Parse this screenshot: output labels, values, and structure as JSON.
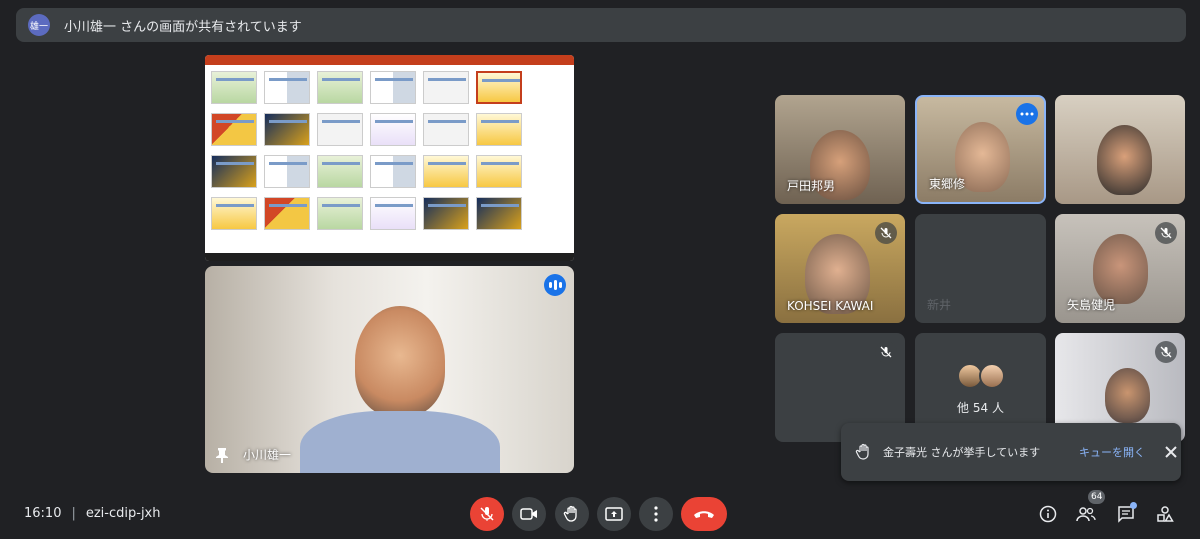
{
  "banner": {
    "avatar_text": "雄一",
    "text": "小川雄一 さんの画面が共有されています"
  },
  "presenter": {
    "name": "小川雄一"
  },
  "participants": [
    {
      "name": "戸田邦男"
    },
    {
      "name": "東郷修"
    },
    {
      "name": ""
    },
    {
      "name": "KOHSEI KAWAI"
    },
    {
      "name": "新井"
    },
    {
      "name": "矢島健児"
    },
    {
      "name": ""
    },
    {
      "name": ""
    }
  ],
  "others": {
    "label": "他 54 人"
  },
  "toast": {
    "text": "金子壽光 さんが挙手しています",
    "link": "キューを開く"
  },
  "meeting": {
    "time": "16:10",
    "code": "ezi-cdip-jxh",
    "participant_count": "64"
  },
  "colors": {
    "background": "#202124",
    "tile": "#3c4043",
    "danger": "#ea4335",
    "accent": "#1a73e8",
    "link": "#8ab4f8"
  }
}
